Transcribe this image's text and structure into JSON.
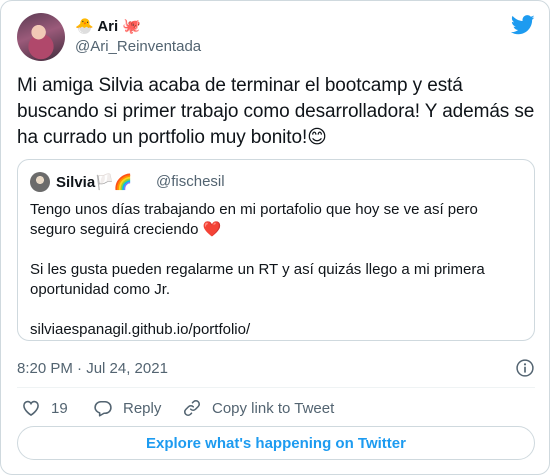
{
  "author": {
    "name": "Ari",
    "name_emoji": "🐣",
    "name_suffix_emoji": "🐙",
    "handle": "@Ari_Reinventada"
  },
  "tweet": {
    "text": "Mi amiga Silvia acaba de terminar el bootcamp y está buscando si primer trabajo como desarrolladora! Y además se ha currado un portfolio muy bonito!😊"
  },
  "quote": {
    "name": "Silvia",
    "name_emojis": "🏳️🌈",
    "handle": "@fischesil",
    "line1": "Tengo unos días trabajando en mi portafolio que hoy se ve así pero seguro seguirá creciendo ",
    "line1_emoji": "❤️",
    "line2": "Si les  gusta pueden regalarme un RT  y así quizás llego a mi primera oportunidad como Jr.",
    "line3": "silviaespanagil.github.io/portfolio/"
  },
  "meta": {
    "date": "8:20 PM · Jul 24, 2021"
  },
  "actions": {
    "likes": "19",
    "reply": "Reply",
    "copy_link": "Copy link to Tweet"
  },
  "explore": {
    "label": "Explore what's happening on Twitter"
  },
  "colors": {
    "accent": "#1d9bf0",
    "heart": "#e0245e",
    "text": "#0f1419",
    "muted": "#536471",
    "border": "#cfd9de"
  },
  "icons": [
    "twitter-bird-icon",
    "info-icon",
    "heart-icon",
    "reply-icon",
    "link-icon"
  ]
}
